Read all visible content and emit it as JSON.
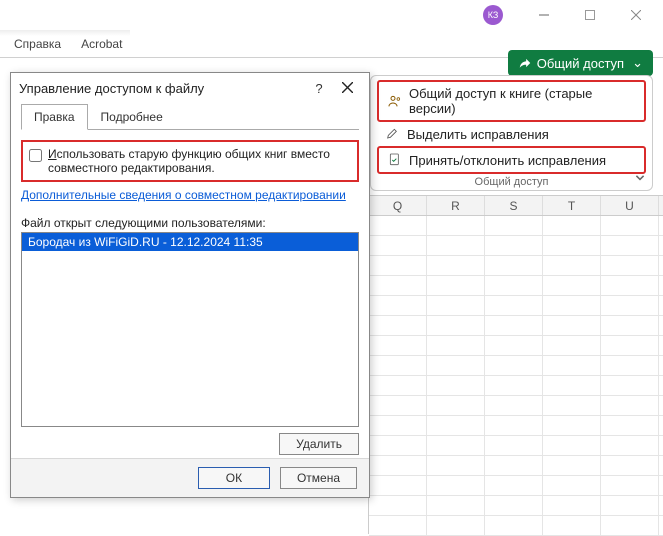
{
  "titlebar": {
    "avatar_initials": "КЗ"
  },
  "ribbon": {
    "tabs": {
      "help": "Справка",
      "acrobat": "Acrobat"
    },
    "share_button": "Общий доступ",
    "items": {
      "share_legacy": "Общий доступ к книге (старые версии)",
      "highlight_changes": "Выделить исправления",
      "accept_reject": "Принять/отклонить исправления"
    },
    "group_label": "Общий доступ"
  },
  "sheet": {
    "cols": [
      "Q",
      "R",
      "S",
      "T",
      "U"
    ]
  },
  "dialog": {
    "title": "Управление доступом к файлу",
    "help_symbol": "?",
    "tabs": {
      "edit": "Правка",
      "more": "Подробнее"
    },
    "checkbox_label_prefix": "И",
    "checkbox_label_rest": "спользовать старую функцию общих книг вместо совместного редактирования.",
    "coauth_link": "Дополнительные сведения о совместном редактировании",
    "users_label": "Файл открыт следующими пользователями:",
    "users": [
      "Бородач из WiFiGiD.RU - 12.12.2024 11:35"
    ],
    "buttons": {
      "delete": "Удалить",
      "ok": "ОК",
      "cancel": "Отмена"
    }
  }
}
